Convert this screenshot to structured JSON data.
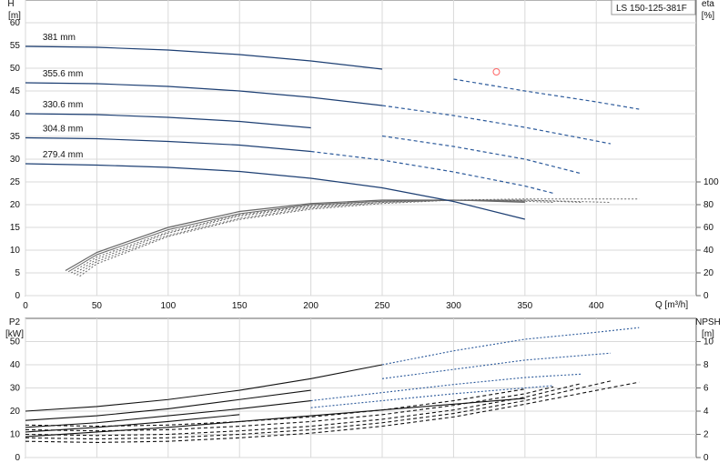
{
  "chart_data": [
    {
      "type": "line",
      "panel": "upper",
      "title": "LS 150-125-381F",
      "xlabel": "Q [m³/h]",
      "left_axis_label_line1": "H",
      "left_axis_label_line2": "[m]",
      "right_axis_label_line1": "eta",
      "right_axis_label_line2": "[%]",
      "xlim": [
        0,
        470
      ],
      "ylim": [
        0,
        65
      ],
      "xticks": [
        0,
        50,
        100,
        150,
        200,
        250,
        300,
        350,
        400
      ],
      "yticks": [
        0,
        5,
        10,
        15,
        20,
        25,
        30,
        35,
        40,
        45,
        50,
        55,
        60
      ],
      "right_ylim": [
        0,
        260
      ],
      "right_yticks": [
        0,
        20,
        40,
        60,
        80,
        100
      ],
      "grid": true,
      "colors": {
        "head_solid": "#1d3f73",
        "head_dashed": "#2c5a9b",
        "efficiency": "#666666",
        "duty_point": "#ff6666"
      },
      "head_series": [
        {
          "name": "381 mm",
          "x": [
            0,
            50,
            100,
            150,
            200,
            250,
            300,
            350,
            400,
            430
          ],
          "y": [
            54.8,
            54.6,
            54.0,
            53.0,
            51.6,
            49.8,
            47.6,
            45.0,
            42.6,
            41.0
          ]
        },
        {
          "name": "355.6 mm",
          "x": [
            0,
            50,
            100,
            150,
            200,
            250,
            300,
            350,
            400,
            410
          ],
          "y": [
            46.8,
            46.6,
            46.0,
            45.0,
            43.6,
            41.8,
            39.6,
            37.0,
            34.0,
            33.4
          ]
        },
        {
          "name": "330.6 mm",
          "x": [
            0,
            50,
            100,
            150,
            200,
            250,
            300,
            350,
            390
          ],
          "y": [
            40.0,
            39.8,
            39.2,
            38.3,
            36.9,
            35.1,
            32.8,
            30.0,
            26.8
          ]
        },
        {
          "name": "304.8 mm",
          "x": [
            0,
            50,
            100,
            150,
            200,
            250,
            300,
            350,
            370
          ],
          "y": [
            34.7,
            34.5,
            33.9,
            33.1,
            31.7,
            29.8,
            27.2,
            24.1,
            22.5
          ]
        },
        {
          "name": "279.4 mm",
          "x": [
            0,
            50,
            100,
            150,
            200,
            250,
            300,
            350
          ],
          "y": [
            29.0,
            28.7,
            28.2,
            27.3,
            25.8,
            23.7,
            20.7,
            16.8
          ]
        }
      ],
      "efficiency_series": [
        {
          "x": [
            28,
            50,
            100,
            150,
            200,
            250,
            300,
            350
          ],
          "y": [
            22,
            38,
            60,
            74,
            81,
            84,
            84,
            83
          ]
        },
        {
          "x": [
            30,
            50,
            100,
            150,
            200,
            250,
            300,
            350
          ],
          "y": [
            21,
            36,
            58,
            72,
            80,
            83,
            84,
            82
          ]
        },
        {
          "x": [
            32,
            50,
            100,
            150,
            200,
            250,
            300,
            350,
            370
          ],
          "y": [
            20,
            34,
            56,
            71,
            79,
            83,
            84,
            83,
            82
          ]
        },
        {
          "x": [
            34,
            50,
            100,
            150,
            200,
            250,
            300,
            350,
            390
          ],
          "y": [
            19,
            32,
            55,
            70,
            78,
            82,
            84,
            84,
            82
          ]
        },
        {
          "x": [
            36,
            50,
            100,
            150,
            200,
            250,
            300,
            350,
            410
          ],
          "y": [
            18,
            30,
            53,
            68,
            77,
            82,
            84,
            84,
            82
          ]
        },
        {
          "x": [
            38,
            50,
            100,
            150,
            200,
            250,
            300,
            350,
            430
          ],
          "y": [
            17,
            28,
            52,
            67,
            76,
            81,
            84,
            85,
            85
          ]
        }
      ],
      "duty_point": {
        "x": 330,
        "y": 49.2
      }
    },
    {
      "type": "line",
      "panel": "lower",
      "left_axis_label_line1": "P2",
      "left_axis_label_line2": "[kW]",
      "right_axis_label_line1": "NPSH",
      "right_axis_label_line2": "[m]",
      "xlim": [
        0,
        470
      ],
      "ylim": [
        0,
        60
      ],
      "yticks": [
        0,
        10,
        20,
        30,
        40,
        50
      ],
      "right_ylim": [
        0,
        12
      ],
      "right_yticks": [
        0,
        2,
        4,
        6,
        8,
        10
      ],
      "grid": true,
      "colors": {
        "power_solid": "#111111",
        "power_dashed": "#2c5a9b",
        "npsh": "#111111"
      },
      "power_series": [
        {
          "x": [
            0,
            50,
            100,
            150,
            200,
            250,
            300,
            350,
            400,
            430
          ],
          "y": [
            20,
            22,
            25,
            29,
            34,
            40,
            46,
            51,
            54,
            56
          ]
        },
        {
          "x": [
            0,
            50,
            100,
            150,
            200,
            250,
            300,
            350,
            400,
            410
          ],
          "y": [
            16,
            18,
            21,
            25,
            29,
            34,
            38,
            42,
            44.5,
            45
          ]
        },
        {
          "x": [
            0,
            50,
            100,
            150,
            200,
            250,
            300,
            350,
            390
          ],
          "y": [
            13,
            15,
            18,
            21,
            24.5,
            28,
            31.5,
            34.5,
            36
          ]
        },
        {
          "x": [
            0,
            50,
            100,
            150,
            200,
            250,
            300,
            350,
            370
          ],
          "y": [
            11,
            13,
            15.5,
            18.5,
            21.5,
            24.5,
            27.5,
            30,
            31
          ]
        },
        {
          "x": [
            0,
            50,
            100,
            150,
            200,
            250,
            300,
            350
          ],
          "y": [
            9,
            11,
            13,
            15.5,
            18,
            20.5,
            23,
            25.5
          ]
        }
      ],
      "npsh_series": [
        {
          "x": [
            0,
            50,
            100,
            150,
            200,
            250,
            300,
            350
          ],
          "y": [
            2.8,
            2.7,
            2.8,
            3.1,
            3.5,
            4.1,
            4.9,
            5.9
          ]
        },
        {
          "x": [
            0,
            50,
            100,
            150,
            200,
            250,
            300,
            350,
            370
          ],
          "y": [
            2.4,
            2.3,
            2.4,
            2.7,
            3.1,
            3.7,
            4.5,
            5.5,
            6.1
          ]
        },
        {
          "x": [
            0,
            50,
            100,
            150,
            200,
            250,
            300,
            350,
            390
          ],
          "y": [
            2.0,
            1.9,
            2.0,
            2.3,
            2.7,
            3.3,
            4.1,
            5.2,
            6.4
          ]
        },
        {
          "x": [
            0,
            50,
            100,
            150,
            200,
            250,
            300,
            350,
            410
          ],
          "y": [
            1.7,
            1.6,
            1.7,
            2.0,
            2.4,
            3.0,
            3.8,
            4.9,
            6.6
          ]
        },
        {
          "x": [
            0,
            50,
            100,
            150,
            200,
            250,
            300,
            350,
            430
          ],
          "y": [
            1.4,
            1.3,
            1.4,
            1.7,
            2.1,
            2.7,
            3.5,
            4.6,
            6.5
          ]
        }
      ]
    }
  ]
}
